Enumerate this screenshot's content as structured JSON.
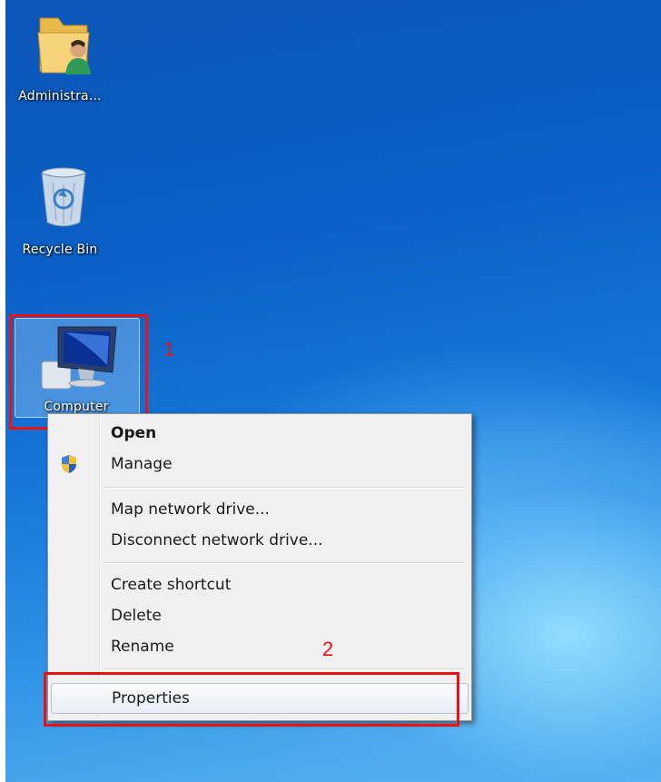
{
  "desktop": {
    "icons": [
      {
        "label": "Administra...",
        "icon": "user-folder-icon"
      },
      {
        "label": "Recycle Bin",
        "icon": "recycle-bin-icon"
      },
      {
        "label": "Computer",
        "icon": "computer-icon"
      }
    ]
  },
  "annotations": {
    "step1": "1",
    "step2": "2",
    "highlight_color": "#ee1111"
  },
  "context_menu": {
    "items": [
      {
        "label": "Open",
        "bold": true
      },
      {
        "label": "Manage",
        "icon": "uac-shield-icon"
      },
      {
        "label": "Map network drive..."
      },
      {
        "label": "Disconnect network drive..."
      },
      {
        "label": "Create shortcut"
      },
      {
        "label": "Delete"
      },
      {
        "label": "Rename"
      },
      {
        "label": "Properties",
        "highlighted": true
      }
    ]
  }
}
